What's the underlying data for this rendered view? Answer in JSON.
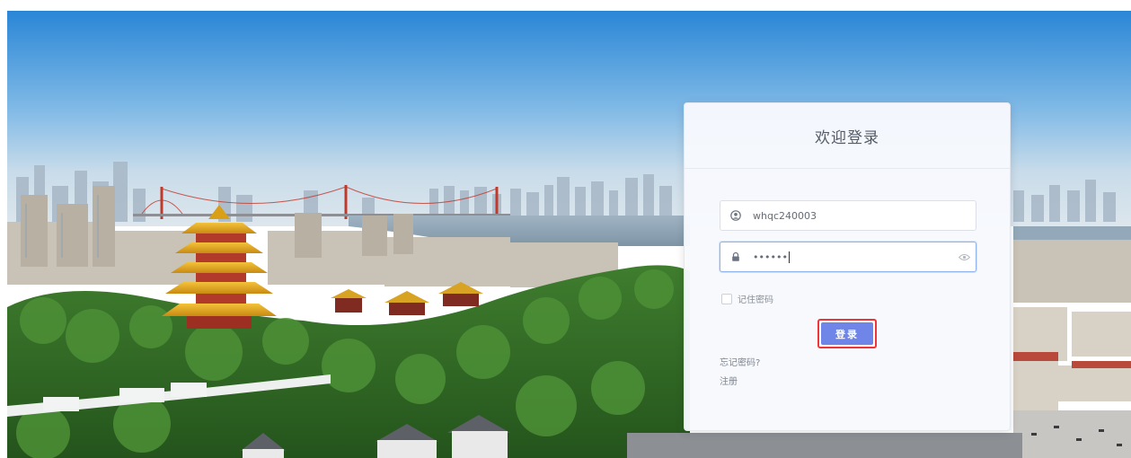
{
  "login": {
    "title": "欢迎登录",
    "username": {
      "value": "whqc240003",
      "icon": "user-circle-icon"
    },
    "password": {
      "masked_value": "••••••",
      "icon": "lock-icon",
      "toggle_icon": "eye-icon"
    },
    "remember_label": "记住密码",
    "remember_checked": false,
    "submit_label": "登录",
    "forgot_link": "忘记密码?",
    "register_link": "注册"
  },
  "colors": {
    "primary_button": "#6f86e8",
    "highlight_border": "#f0353a",
    "focus_border": "#8fb4ee"
  }
}
